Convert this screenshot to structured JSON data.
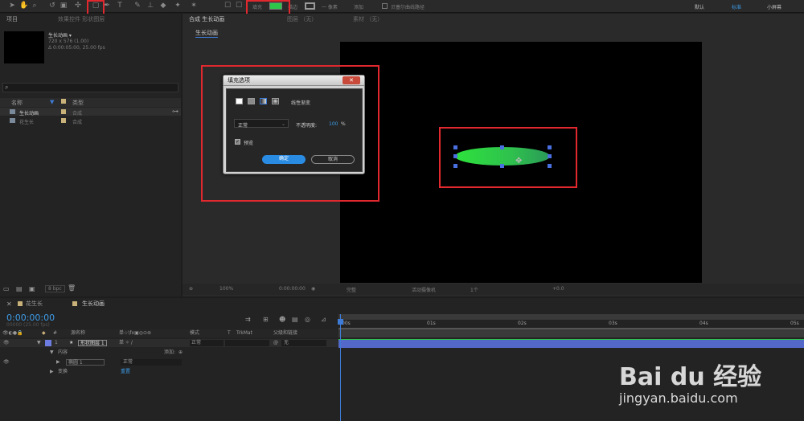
{
  "toolbar": {
    "fill_label": "填充",
    "stroke_label": "描边",
    "stroke_value": "一 像素",
    "add_label": "添加",
    "bezier_label": "贝塞尔曲线路径",
    "workspace_default": "默认",
    "workspace_standard": "标准",
    "workspace_small": "小屏幕",
    "fill_color": "#2ec64a",
    "highlight_color": "#e0282e"
  },
  "project_panel": {
    "tab_project": "项目",
    "tab_effects": "效果控件 形状图层",
    "comp_name": "生长动画 ▾",
    "comp_size": "720 x 576 (1.00)",
    "comp_duration": "Δ 0:00:05:00, 25.00 fps",
    "search_placeholder": "",
    "col_name": "名称",
    "col_type": "类型",
    "items": [
      {
        "name": "生长动画",
        "type": "合成"
      },
      {
        "name": "花生长",
        "type": "合成"
      }
    ],
    "bpc": "8 bpc"
  },
  "comp_panel": {
    "tab_comp": "合成 生长动画",
    "tab_layer": "图层 （无）",
    "tab_footage": "素材 （无）",
    "subtab": "生长动画",
    "zoom": "100%",
    "timecode": "0:00:00:00",
    "resolution": "完整",
    "camera": "活动摄像机",
    "views": "1个",
    "exposure": "+0.0"
  },
  "fill_dialog": {
    "title": "填充选项",
    "gradient_label": "线性渐变",
    "mode": "正常",
    "opacity_label": "不透明度:",
    "opacity_value": "100",
    "opacity_unit": "%",
    "preview_label": "预览",
    "ok_label": "确定",
    "cancel_label": "取消"
  },
  "timeline": {
    "tab_1": "花生长",
    "tab_2": "生长动画",
    "timecode": "0:00:00:00",
    "frames": "00000 (25.00 fps)",
    "col_num": "#",
    "col_source": "源名称",
    "col_switches": "单☆\\fx▣◎⊙⊚",
    "col_mode": "模式",
    "col_t": "T",
    "col_trkmat": "TrkMat",
    "col_parent": "父级和链接",
    "layer": {
      "index": "1",
      "name": "形状图层 1",
      "switches": "单 ✧ /",
      "mode": "正常",
      "parent": "无"
    },
    "contents_label": "内容",
    "add_label": "添加:",
    "ellipse_label": "椭圆 1",
    "ellipse_mode": "正常",
    "transform_label": "变换",
    "reset_label": "重置",
    "ruler": [
      "00s",
      "01s",
      "02s",
      "03s",
      "04s",
      "05s"
    ],
    "bar_color": "#5368c8"
  },
  "watermark": {
    "brand": "Bai du 经验",
    "url": "jingyan.baidu.com"
  }
}
